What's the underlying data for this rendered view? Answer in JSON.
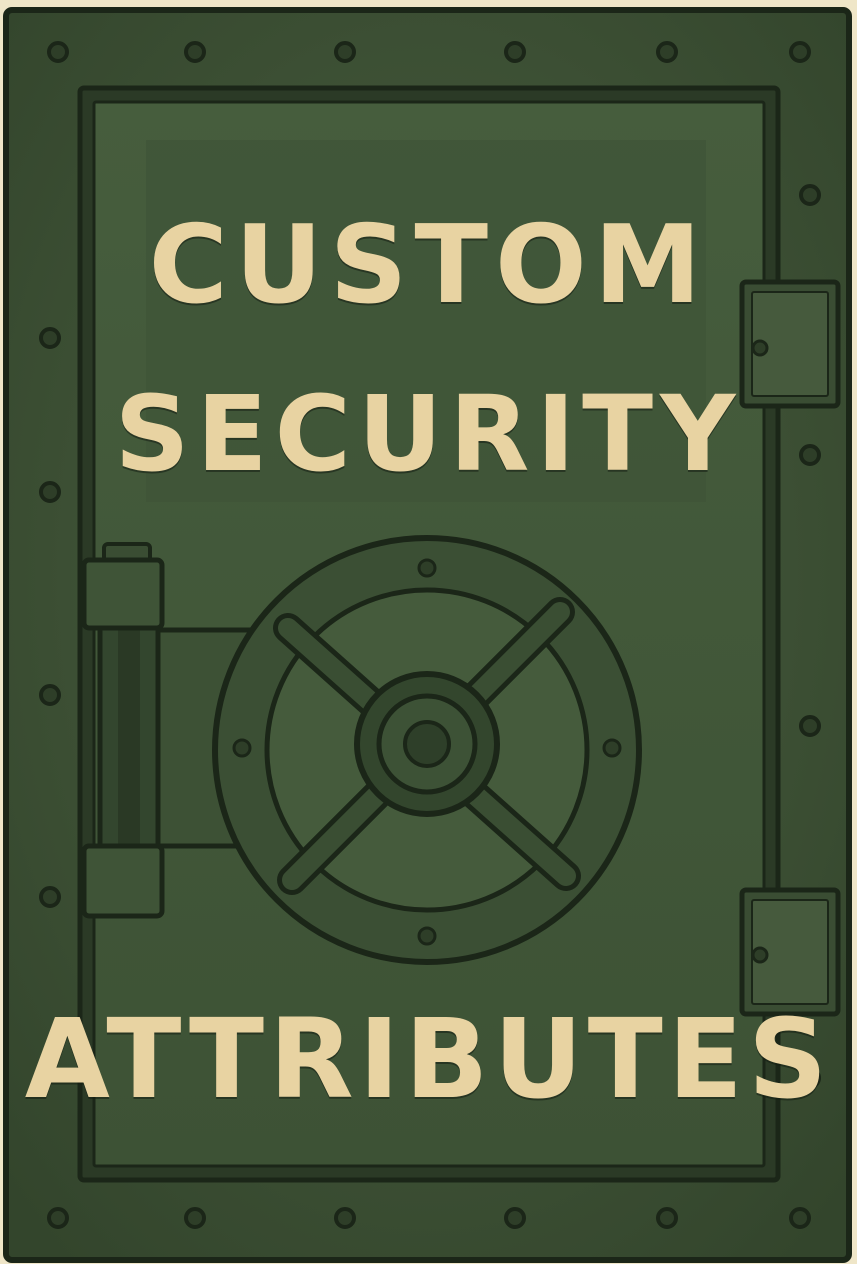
{
  "title": {
    "line1": "CUSTOM",
    "line2": "SECURITY",
    "line3": "ATTRIBUTES"
  },
  "colors": {
    "background": "#efe6c8",
    "door": "#3e5135",
    "door_shadow": "#2b3a26",
    "inner_panel": "#435a3a",
    "outline": "#1b2618",
    "text": "#e8d3a2"
  },
  "icons": {
    "door": "vault-door-icon",
    "wheel": "vault-wheel-icon",
    "hinge": "hinge-icon",
    "bolt": "bolt-icon"
  }
}
